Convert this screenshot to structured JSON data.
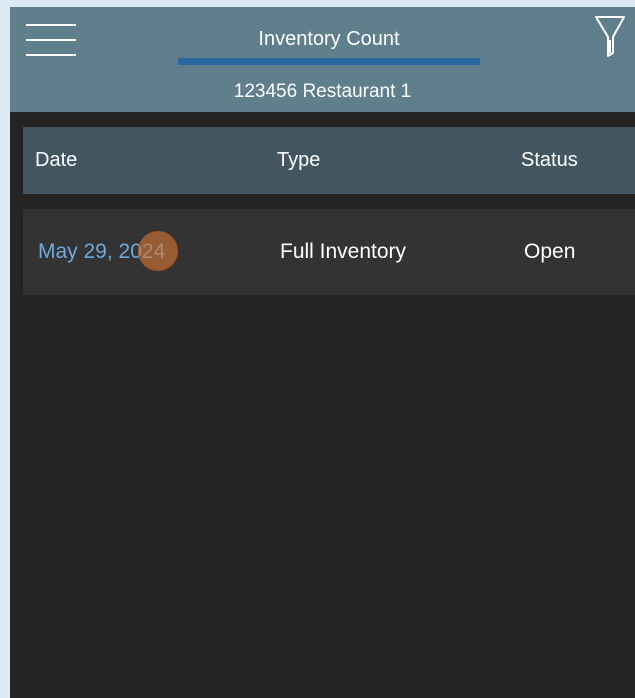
{
  "header": {
    "title": "Inventory Count",
    "subtitle": "123456 Restaurant 1",
    "menu_icon": "hamburger-menu-icon",
    "filter_icon": "filter-funnel-icon"
  },
  "table": {
    "columns": [
      "Date",
      "Type",
      "Status"
    ],
    "rows": [
      {
        "date": "May 29, 2024",
        "type": "Full Inventory",
        "status": "Open"
      }
    ]
  },
  "colors": {
    "header_bg": "#5f7f8c",
    "tab_underline": "#2869a0",
    "table_header_bg": "#425560",
    "row_bg": "#333333",
    "page_bg": "#242424",
    "date_link": "#6fa8dc"
  }
}
